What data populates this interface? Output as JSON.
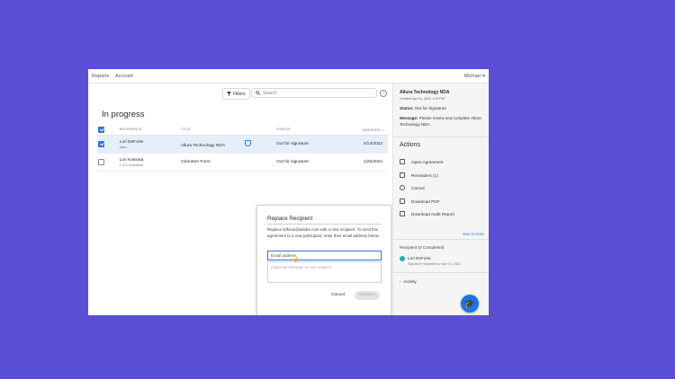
{
  "nav": {
    "reports": "Reports",
    "account": "Account",
    "user": "Michael ▾"
  },
  "toolbar": {
    "filters": "Filters",
    "search_placeholder": "Search",
    "help": "?"
  },
  "page_title": "In progress",
  "table": {
    "headers": {
      "recipients": "RECIPIENTS",
      "title": "TITLE",
      "status": "STATUS",
      "modified": "MODIFIED"
    },
    "rows": [
      {
        "recipient": "Lori DeForte",
        "sub": "sales",
        "title": "Allura Technology NDA",
        "status": "Out for signature",
        "modified": "4/14/2022",
        "selected": true
      },
      {
        "recipient": "Lori Kassata",
        "sub": "1 of 2 completed",
        "title": "Volunteer Form",
        "status": "Out for signature",
        "modified": "1/25/2022",
        "selected": false
      }
    ]
  },
  "dialog": {
    "title": "Replace Recipient",
    "description": "Replace lidfonio@adobe.com with a new recipient. To send this agreement to a new participant, enter their email address below.",
    "email_placeholder": "Email address",
    "message_placeholder": "(Optional) Message to new recipient",
    "cancel": "Cancel",
    "replace": "Replace"
  },
  "side": {
    "agreement_title": "Allura Technology NDA",
    "created": "Created Apr 14, 2022 1:19 PM",
    "status_label": "Status:",
    "status_value": "Out for Signature",
    "message_label": "Message:",
    "message_value": "Please review and complete Allura Technology NDA.",
    "actions_title": "Actions",
    "actions": [
      "Open Agreement",
      "Reminders (1)",
      "Cancel",
      "Download PDF",
      "Download Audit Report"
    ],
    "see_more": "See 6 more",
    "recipients_title": "Recipient (0 Completed)",
    "recipient_name": "Lori DeForte",
    "recipient_sub": "Signature requested on Apr 14, 2022",
    "activity": "Activity"
  },
  "colors": {
    "background": "#5a4fd4",
    "accent": "#2c75d5",
    "selected_row": "#e5effa",
    "recipient_dot": "#1fb4a0"
  },
  "icons": {
    "filters": "funnel-icon",
    "search": "search-icon",
    "fab": "graduation-cap-icon"
  }
}
